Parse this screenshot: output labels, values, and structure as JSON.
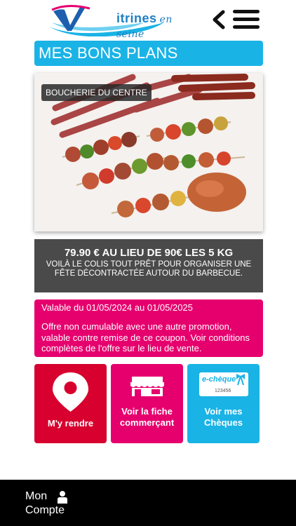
{
  "header": {
    "logo_brand": "itrines",
    "logo_script": "en seine"
  },
  "page": {
    "title": "MES BONS PLANS"
  },
  "offer": {
    "shop_name": "BOUCHERIE DU CENTRE",
    "price_line": "79.90 € AU LIEU DE 90€ LES 5 KG",
    "description": "VOILÀ LE COLIS TOUT PRÊT POUR ORGANISER UNE FÊTE DÉCONTRACTÉE AUTOUR DU BARBECUE.",
    "validity": "Valable du 01/05/2024 au 01/05/2025",
    "conditions": "Offre non cumulable avec une autre promotion, valable contre remise de ce coupon. Voir conditions complètes de l'offre sur le lieu de vente."
  },
  "actions": {
    "go_label": "M'y rendre",
    "shop_label": "Voir la fiche commerçant",
    "cheques_label": "Voir mes Chèques",
    "cheque_card_title": "e-chèque",
    "cheque_card_number": "123456"
  },
  "footer": {
    "account_label_1": "Mon",
    "account_label_2": "Compte"
  },
  "colors": {
    "accent_blue": "#1ab3e6",
    "magenta": "#e6006e",
    "red": "#d7002e",
    "dark_gray": "#4a4a4a"
  }
}
